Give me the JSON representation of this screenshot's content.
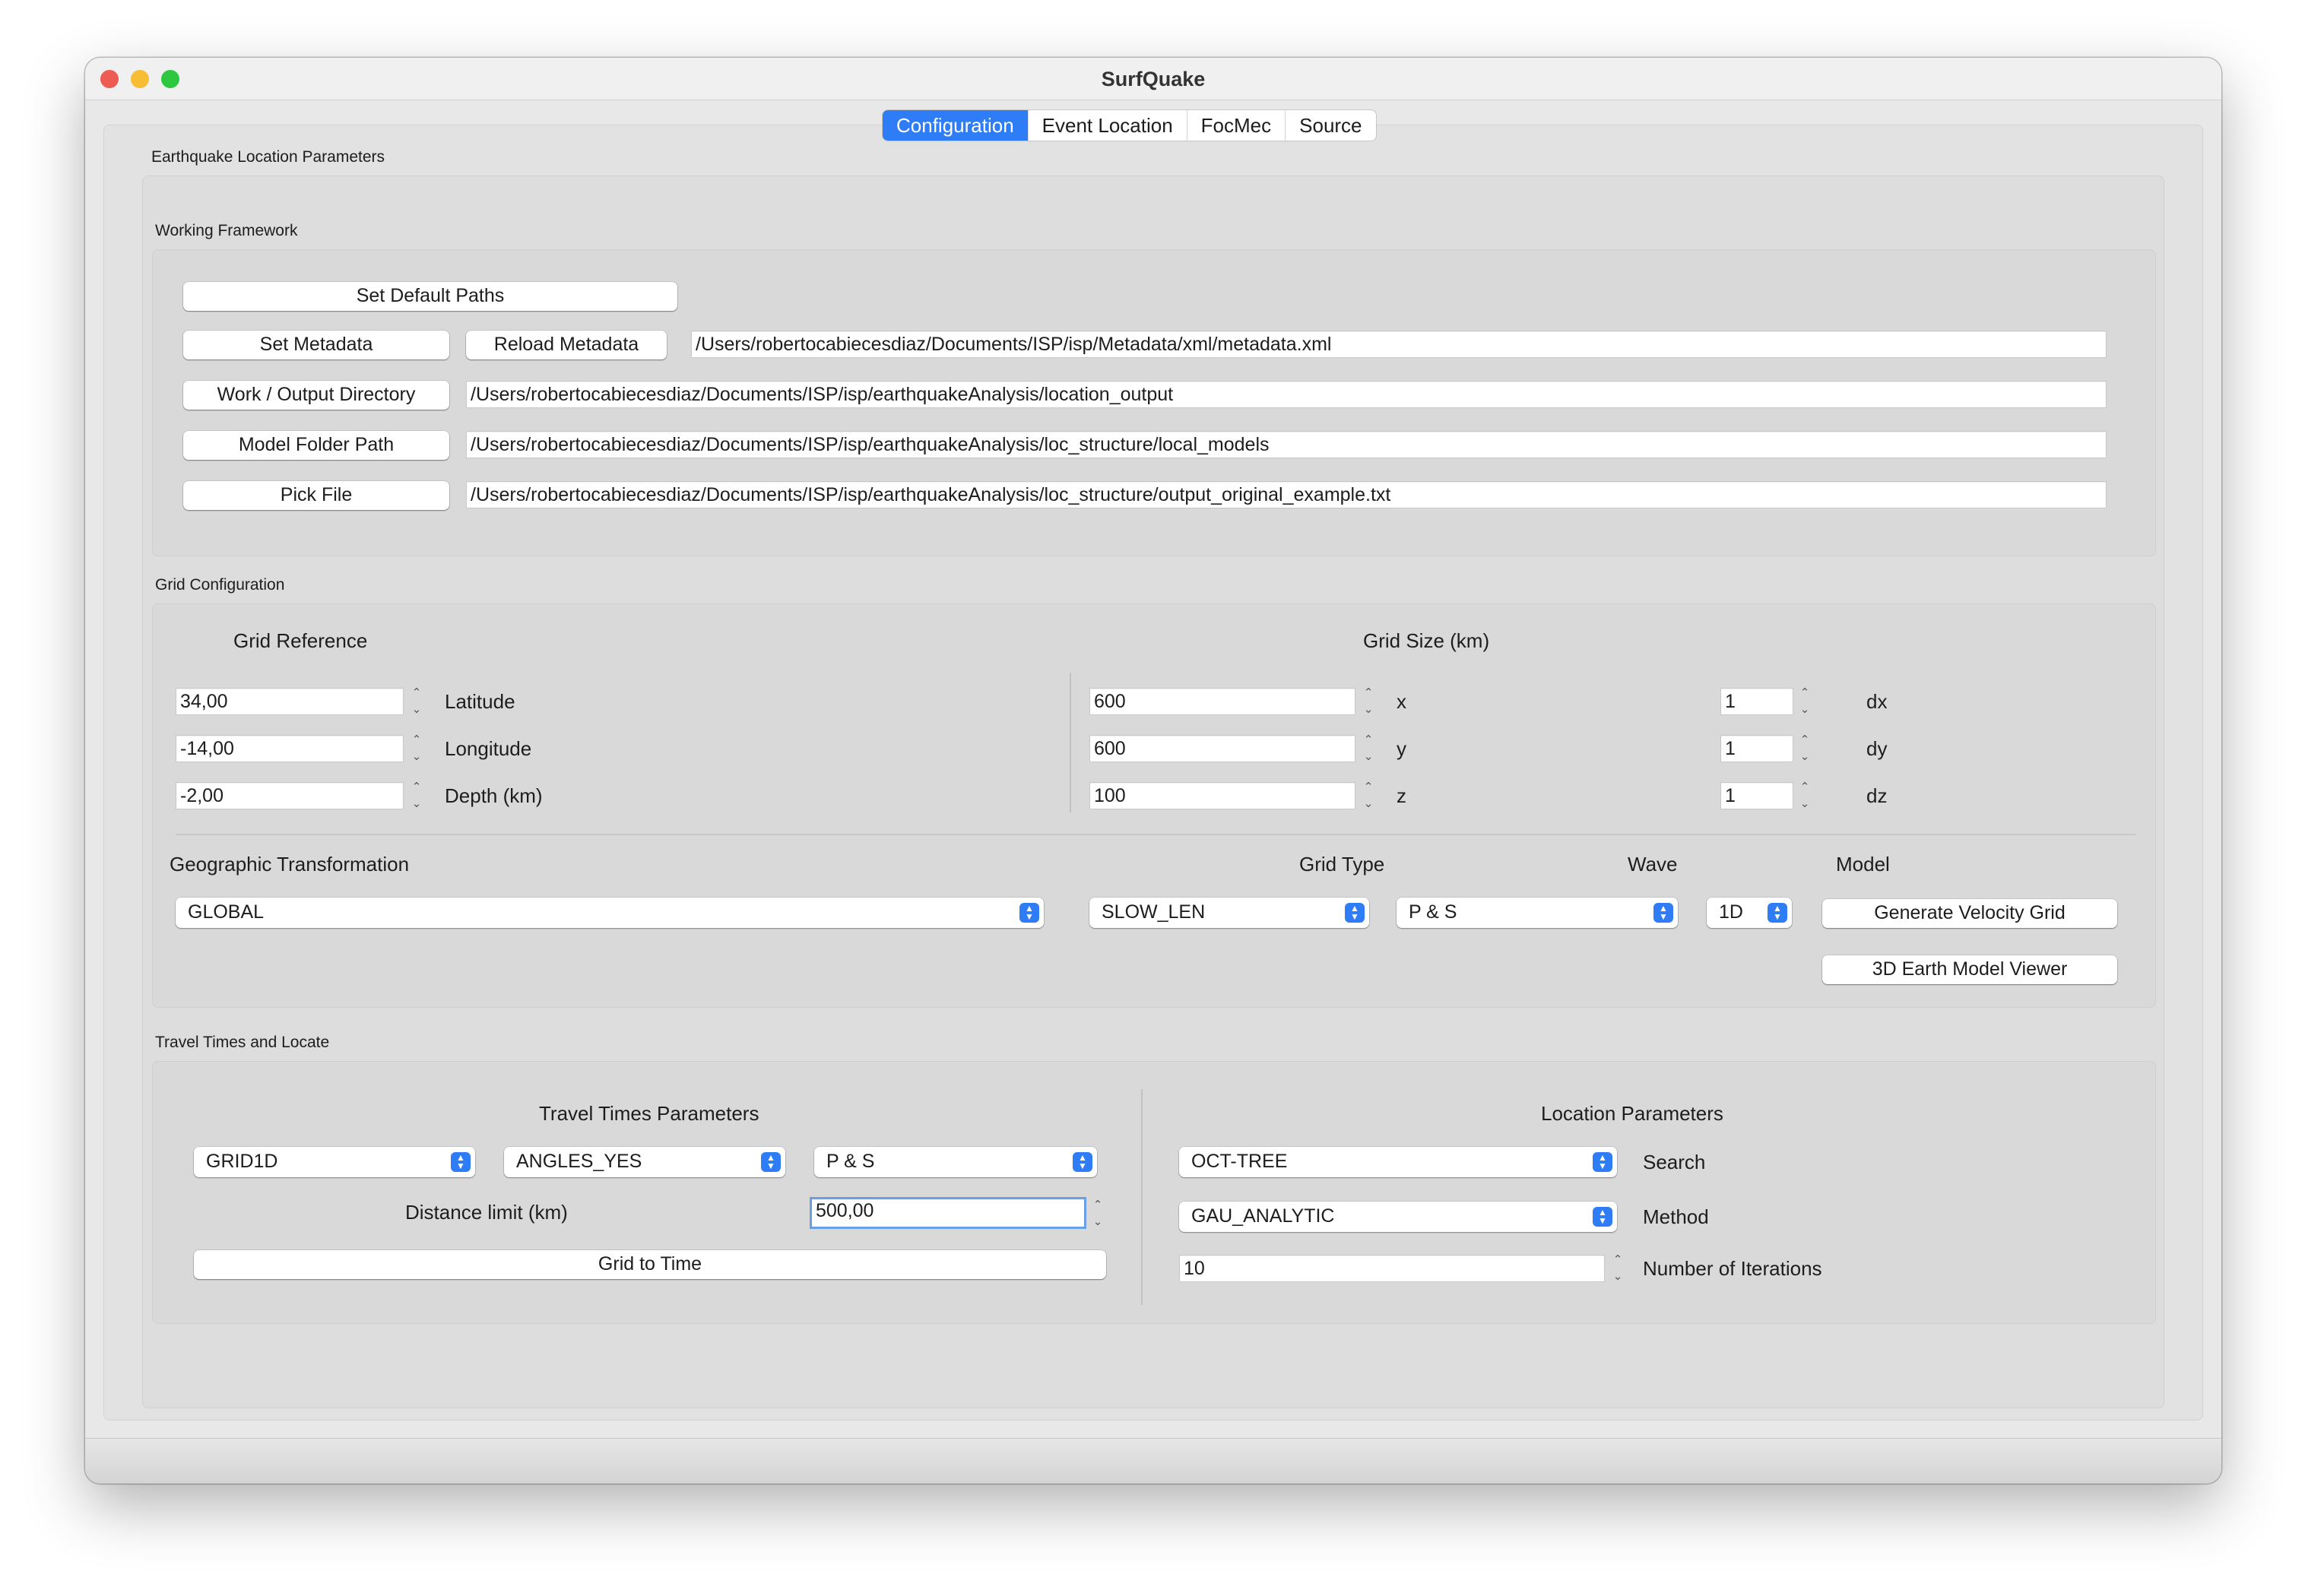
{
  "window": {
    "title": "SurfQuake"
  },
  "tabs": [
    "Configuration",
    "Event Location",
    "FocMec",
    "Source"
  ],
  "colors": {
    "accent": "#2e7cf6",
    "close": "#ee5b53",
    "minimize": "#f7be35",
    "zoom": "#2ec840"
  },
  "location_params": {
    "title": "Earthquake Location Parameters"
  },
  "working": {
    "title": "Working Framework",
    "set_default": "Set Default Paths",
    "set_metadata": "Set Metadata",
    "reload_metadata": "Reload Metadata",
    "metadata_path": "/Users/robertocabiecesdiaz/Documents/ISP/isp/Metadata/xml/metadata.xml",
    "work_dir_btn": "Work / Output Directory",
    "work_dir_path": "/Users/robertocabiecesdiaz/Documents/ISP/isp/earthquakeAnalysis/location_output",
    "model_btn": "Model Folder Path",
    "model_path": "/Users/robertocabiecesdiaz/Documents/ISP/isp/earthquakeAnalysis/loc_structure/local_models",
    "pick_btn": "Pick File",
    "pick_path": "/Users/robertocabiecesdiaz/Documents/ISP/isp/earthquakeAnalysis/loc_structure/output_original_example.txt"
  },
  "grid": {
    "title": "Grid Configuration",
    "reference_title": "Grid Reference",
    "size_title": "Grid Size (km)",
    "latitude": "34,00",
    "latitude_label": "Latitude",
    "longitude": "-14,00",
    "longitude_label": "Longitude",
    "depth": "-2,00",
    "depth_label": "Depth (km)",
    "x": "600",
    "x_label": "x",
    "y": "600",
    "y_label": "y",
    "z": "100",
    "z_label": "z",
    "dx": "1",
    "dx_label": "dx",
    "dy": "1",
    "dy_label": "dy",
    "dz": "1",
    "dz_label": "dz",
    "geo_title": "Geographic Transformation",
    "geo_value": "GLOBAL",
    "type_title": "Grid Type",
    "type_value": "SLOW_LEN",
    "wave_title": "Wave",
    "wave_value": "P & S",
    "model_title": "Model",
    "model_value": "1D",
    "generate": "Generate Velocity Grid",
    "viewer": "3D Earth Model Viewer"
  },
  "travel": {
    "title": "Travel Times and Locate",
    "params_title": "Travel Times Parameters",
    "grid_combo": "GRID1D",
    "angles_combo": "ANGLES_YES",
    "wave_combo": "P & S",
    "distance_label": "Distance limit (km)",
    "distance_value": "500,00",
    "grid_to_time": "Grid to Time",
    "loc_title": "Location Parameters",
    "search_combo": "OCT-TREE",
    "search_label": "Search",
    "method_combo": "GAU_ANALYTIC",
    "method_label": "Method",
    "iterations": "10",
    "iterations_label": "Number of Iterations"
  }
}
